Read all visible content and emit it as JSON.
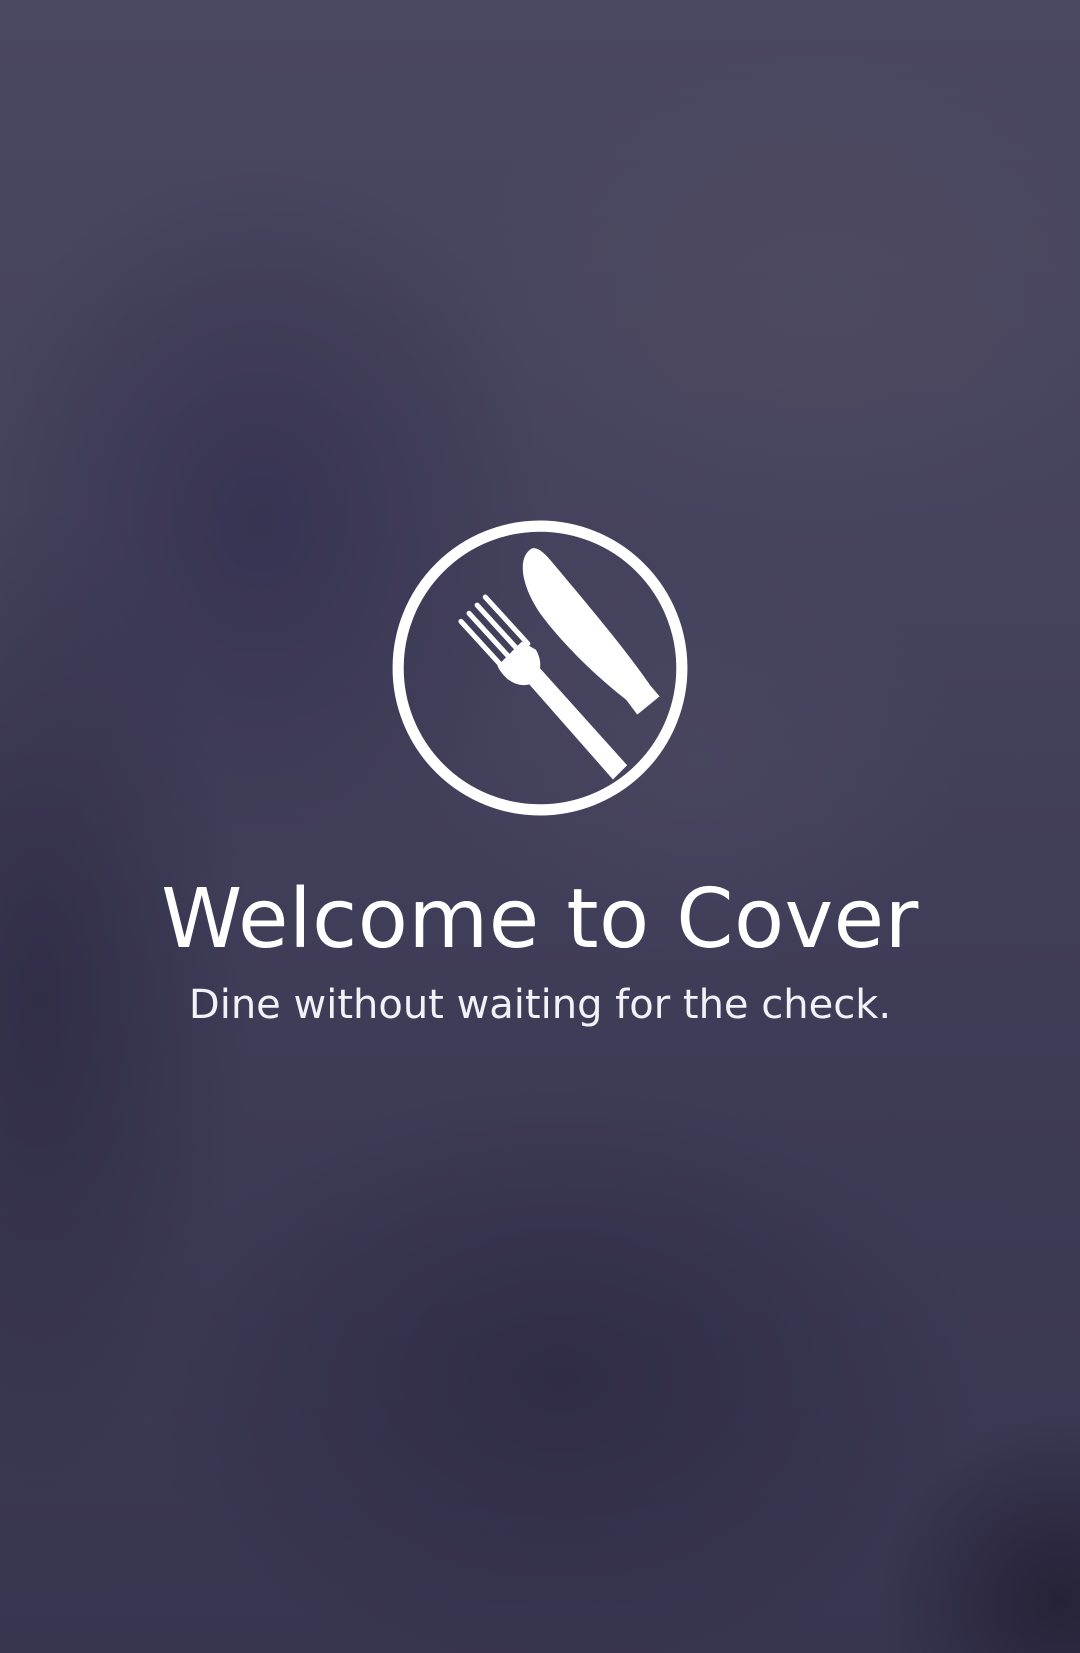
{
  "welcome": {
    "title": "Welcome to Cover",
    "subtitle": "Dine without waiting for the check.",
    "logo_icon": "fork-knife-plate-icon"
  },
  "colors": {
    "background": "#434058",
    "text": "#ffffff"
  }
}
